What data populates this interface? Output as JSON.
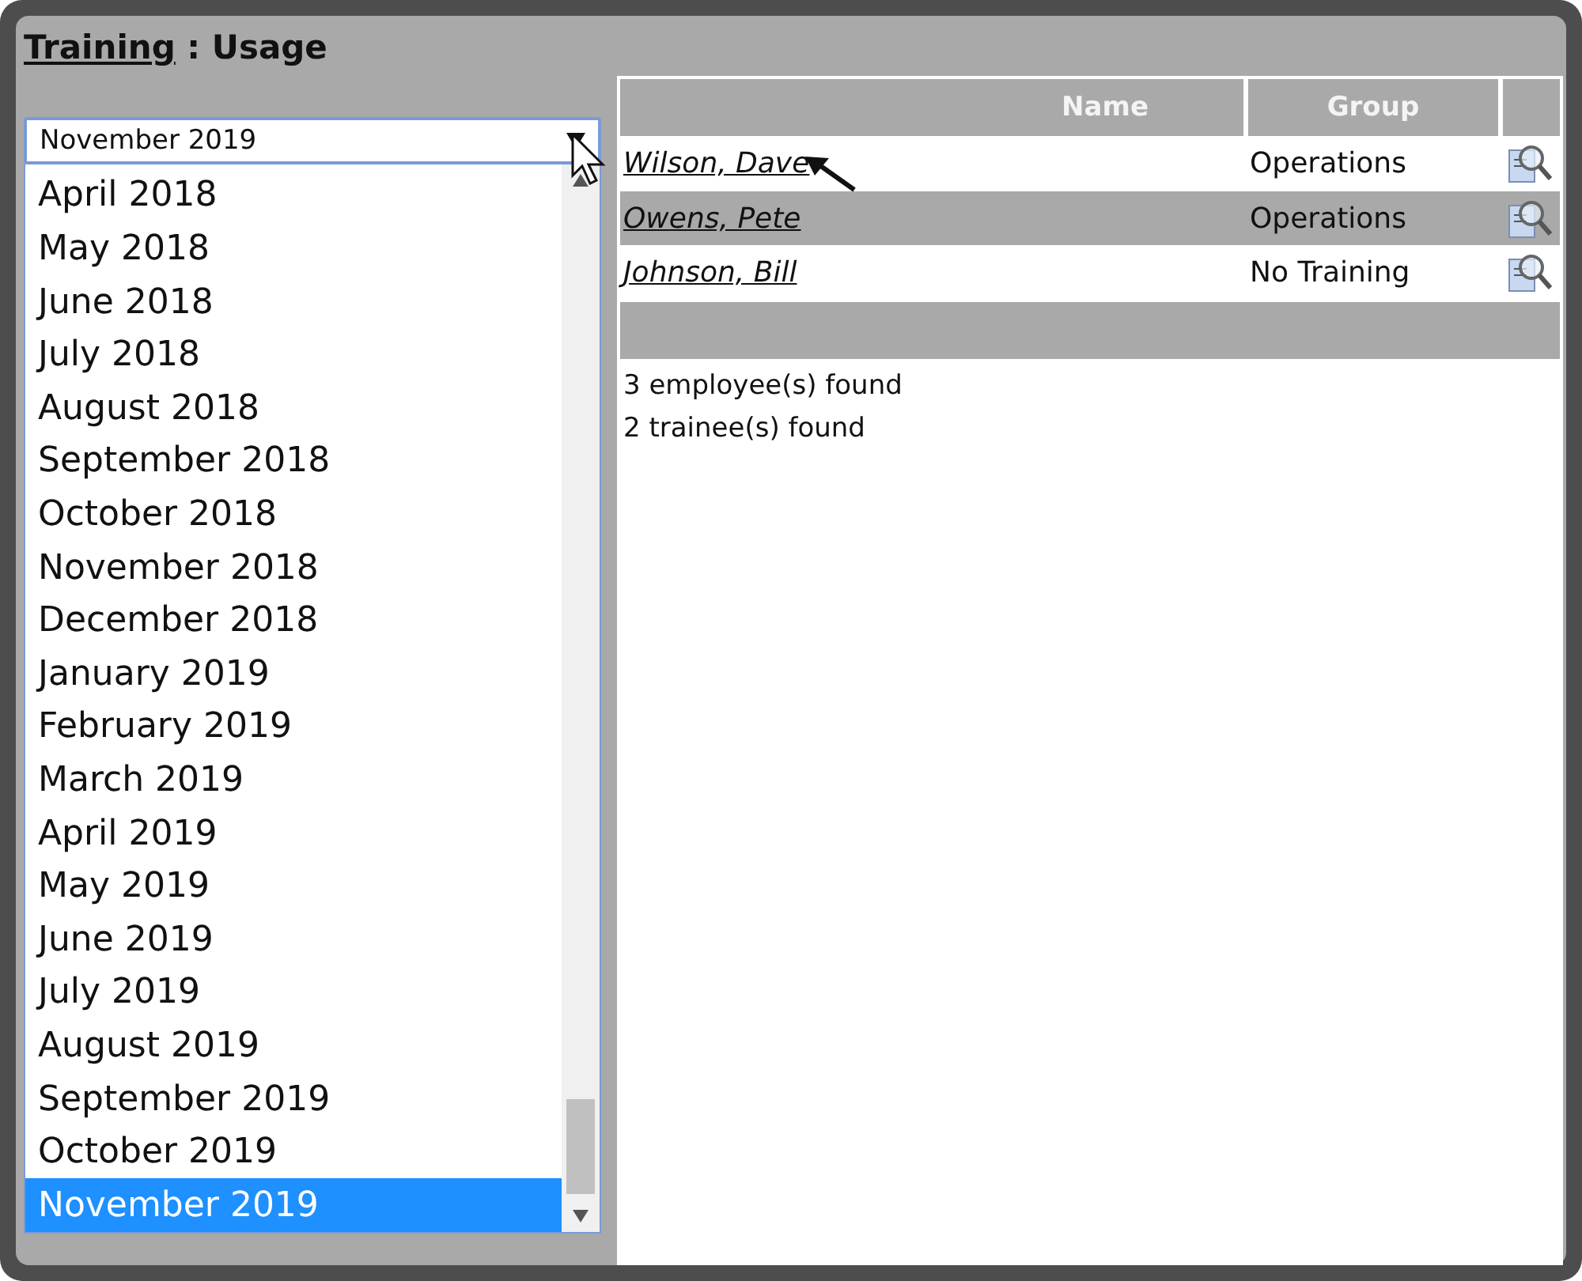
{
  "title": {
    "link": "Training",
    "rest": " : Usage"
  },
  "month_select": {
    "value": "November 2019",
    "options": [
      {
        "label": "April 2018",
        "selected": false
      },
      {
        "label": "May 2018",
        "selected": false
      },
      {
        "label": "June 2018",
        "selected": false
      },
      {
        "label": "July 2018",
        "selected": false
      },
      {
        "label": "August 2018",
        "selected": false
      },
      {
        "label": "September 2018",
        "selected": false
      },
      {
        "label": "October 2018",
        "selected": false
      },
      {
        "label": "November 2018",
        "selected": false
      },
      {
        "label": "December 2018",
        "selected": false
      },
      {
        "label": "January 2019",
        "selected": false
      },
      {
        "label": "February 2019",
        "selected": false
      },
      {
        "label": "March 2019",
        "selected": false
      },
      {
        "label": "April 2019",
        "selected": false
      },
      {
        "label": "May 2019",
        "selected": false
      },
      {
        "label": "June 2019",
        "selected": false
      },
      {
        "label": "July 2019",
        "selected": false
      },
      {
        "label": "August 2019",
        "selected": false
      },
      {
        "label": "September 2019",
        "selected": false
      },
      {
        "label": "October 2019",
        "selected": false
      },
      {
        "label": "November 2019",
        "selected": true
      }
    ]
  },
  "table": {
    "columns": [
      "Name",
      "Group"
    ],
    "rows": [
      {
        "name": "Wilson, Dave",
        "group": "Operations"
      },
      {
        "name": "Owens, Pete",
        "group": "Operations"
      },
      {
        "name": "Johnson, Bill",
        "group": "No Training"
      }
    ]
  },
  "summary": [
    "3 employee(s) found",
    "2 trainee(s) found"
  ]
}
